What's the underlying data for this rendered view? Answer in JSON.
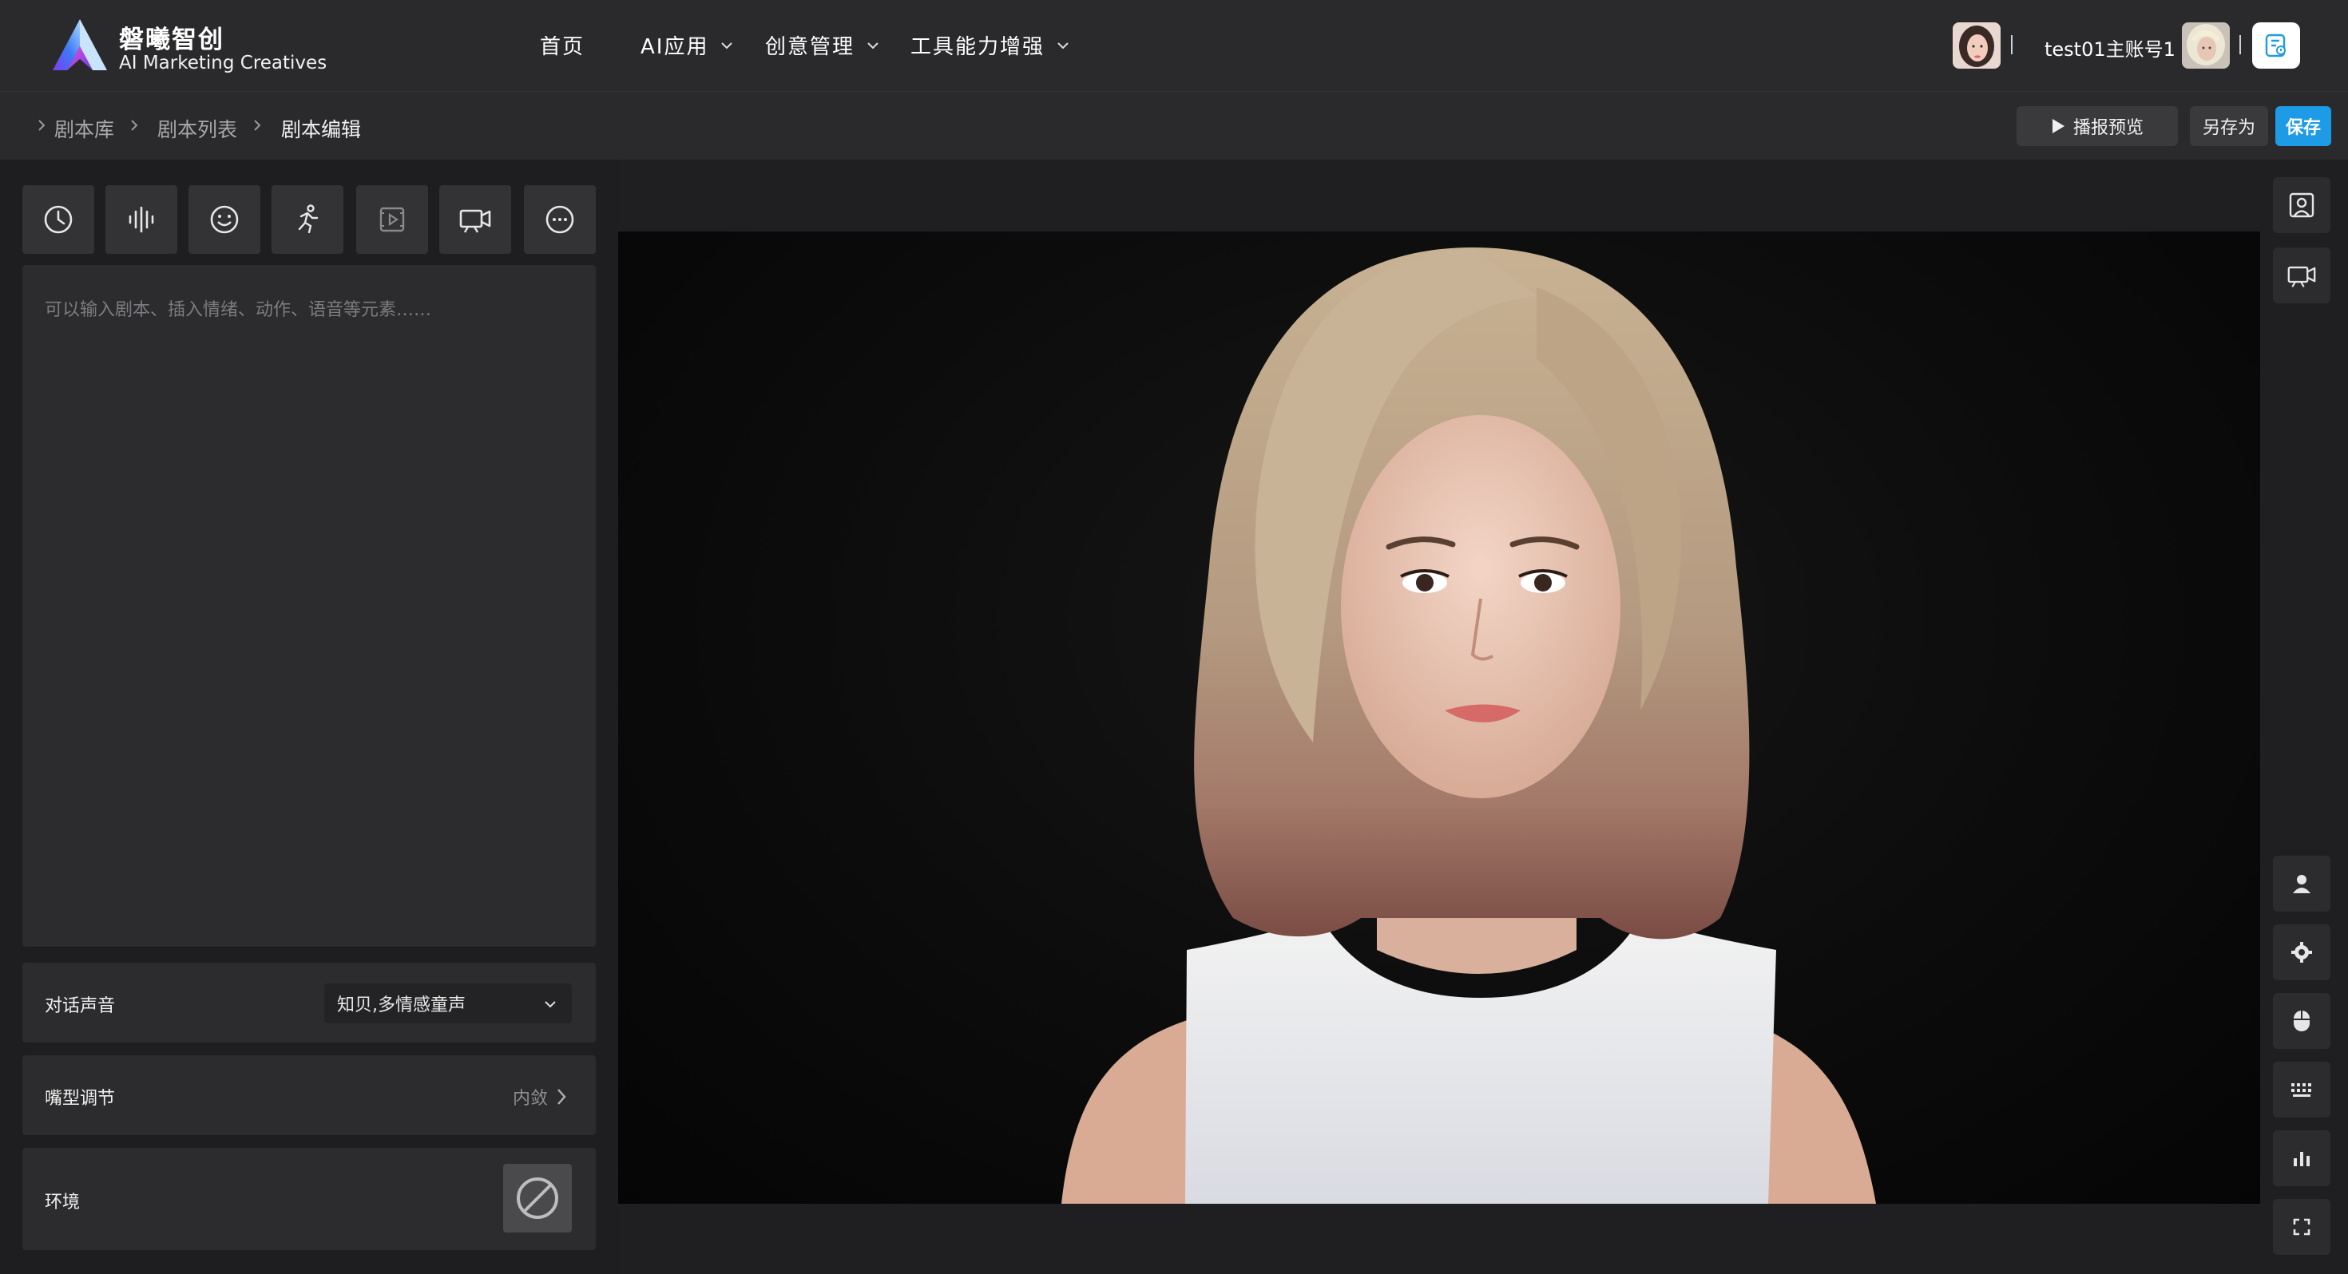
{
  "brand": {
    "name_cn": "磐曦智创",
    "name_en": "AI Marketing Creatives"
  },
  "nav": [
    {
      "label": "首页",
      "has_dropdown": false
    },
    {
      "label": "AI应用",
      "has_dropdown": true
    },
    {
      "label": "创意管理",
      "has_dropdown": true
    },
    {
      "label": "工具能力增强",
      "has_dropdown": true
    }
  ],
  "user": {
    "account": "test01主账号1"
  },
  "breadcrumb": [
    "剧本库",
    "剧本列表",
    "剧本编辑"
  ],
  "actions": {
    "preview_label": "播报预览",
    "save_as_label": "另存为",
    "save_label": "保存"
  },
  "toolbar_icons": [
    "clock-icon",
    "audio-wave-icon",
    "smiley-icon",
    "running-person-icon",
    "video-clip-icon",
    "camera-icon",
    "more-icon"
  ],
  "editor": {
    "placeholder": "可以输入剧本、插入情绪、动作、语音等元素……",
    "value": ""
  },
  "settings": {
    "voice": {
      "label": "对话声音",
      "value": "知贝,多情感童声"
    },
    "mouth": {
      "label": "嘴型调节",
      "value": "内敛"
    },
    "environment": {
      "label": "环境"
    }
  },
  "side_tools": [
    "portrait-icon",
    "camera-icon",
    "person-icon",
    "gear-icon",
    "mouse-icon",
    "keyboard-icon",
    "bar-chart-icon",
    "fullscreen-icon"
  ],
  "colors": {
    "accent": "#1d9be6",
    "header_bg": "#2a2a2c",
    "panel_bg": "#1e1e20",
    "stage_bg": "#0c0c0c"
  }
}
